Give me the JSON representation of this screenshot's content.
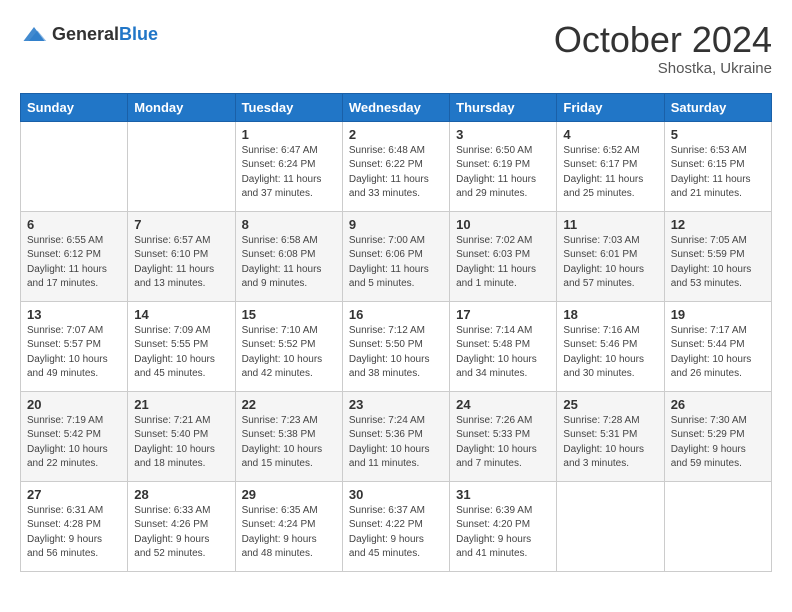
{
  "header": {
    "logo_general": "General",
    "logo_blue": "Blue",
    "month_year": "October 2024",
    "location": "Shostka, Ukraine"
  },
  "days_of_week": [
    "Sunday",
    "Monday",
    "Tuesday",
    "Wednesday",
    "Thursday",
    "Friday",
    "Saturday"
  ],
  "weeks": [
    [
      {
        "day": "",
        "sunrise": "",
        "sunset": "",
        "daylight": ""
      },
      {
        "day": "",
        "sunrise": "",
        "sunset": "",
        "daylight": ""
      },
      {
        "day": "1",
        "sunrise": "Sunrise: 6:47 AM",
        "sunset": "Sunset: 6:24 PM",
        "daylight": "Daylight: 11 hours and 37 minutes."
      },
      {
        "day": "2",
        "sunrise": "Sunrise: 6:48 AM",
        "sunset": "Sunset: 6:22 PM",
        "daylight": "Daylight: 11 hours and 33 minutes."
      },
      {
        "day": "3",
        "sunrise": "Sunrise: 6:50 AM",
        "sunset": "Sunset: 6:19 PM",
        "daylight": "Daylight: 11 hours and 29 minutes."
      },
      {
        "day": "4",
        "sunrise": "Sunrise: 6:52 AM",
        "sunset": "Sunset: 6:17 PM",
        "daylight": "Daylight: 11 hours and 25 minutes."
      },
      {
        "day": "5",
        "sunrise": "Sunrise: 6:53 AM",
        "sunset": "Sunset: 6:15 PM",
        "daylight": "Daylight: 11 hours and 21 minutes."
      }
    ],
    [
      {
        "day": "6",
        "sunrise": "Sunrise: 6:55 AM",
        "sunset": "Sunset: 6:12 PM",
        "daylight": "Daylight: 11 hours and 17 minutes."
      },
      {
        "day": "7",
        "sunrise": "Sunrise: 6:57 AM",
        "sunset": "Sunset: 6:10 PM",
        "daylight": "Daylight: 11 hours and 13 minutes."
      },
      {
        "day": "8",
        "sunrise": "Sunrise: 6:58 AM",
        "sunset": "Sunset: 6:08 PM",
        "daylight": "Daylight: 11 hours and 9 minutes."
      },
      {
        "day": "9",
        "sunrise": "Sunrise: 7:00 AM",
        "sunset": "Sunset: 6:06 PM",
        "daylight": "Daylight: 11 hours and 5 minutes."
      },
      {
        "day": "10",
        "sunrise": "Sunrise: 7:02 AM",
        "sunset": "Sunset: 6:03 PM",
        "daylight": "Daylight: 11 hours and 1 minute."
      },
      {
        "day": "11",
        "sunrise": "Sunrise: 7:03 AM",
        "sunset": "Sunset: 6:01 PM",
        "daylight": "Daylight: 10 hours and 57 minutes."
      },
      {
        "day": "12",
        "sunrise": "Sunrise: 7:05 AM",
        "sunset": "Sunset: 5:59 PM",
        "daylight": "Daylight: 10 hours and 53 minutes."
      }
    ],
    [
      {
        "day": "13",
        "sunrise": "Sunrise: 7:07 AM",
        "sunset": "Sunset: 5:57 PM",
        "daylight": "Daylight: 10 hours and 49 minutes."
      },
      {
        "day": "14",
        "sunrise": "Sunrise: 7:09 AM",
        "sunset": "Sunset: 5:55 PM",
        "daylight": "Daylight: 10 hours and 45 minutes."
      },
      {
        "day": "15",
        "sunrise": "Sunrise: 7:10 AM",
        "sunset": "Sunset: 5:52 PM",
        "daylight": "Daylight: 10 hours and 42 minutes."
      },
      {
        "day": "16",
        "sunrise": "Sunrise: 7:12 AM",
        "sunset": "Sunset: 5:50 PM",
        "daylight": "Daylight: 10 hours and 38 minutes."
      },
      {
        "day": "17",
        "sunrise": "Sunrise: 7:14 AM",
        "sunset": "Sunset: 5:48 PM",
        "daylight": "Daylight: 10 hours and 34 minutes."
      },
      {
        "day": "18",
        "sunrise": "Sunrise: 7:16 AM",
        "sunset": "Sunset: 5:46 PM",
        "daylight": "Daylight: 10 hours and 30 minutes."
      },
      {
        "day": "19",
        "sunrise": "Sunrise: 7:17 AM",
        "sunset": "Sunset: 5:44 PM",
        "daylight": "Daylight: 10 hours and 26 minutes."
      }
    ],
    [
      {
        "day": "20",
        "sunrise": "Sunrise: 7:19 AM",
        "sunset": "Sunset: 5:42 PM",
        "daylight": "Daylight: 10 hours and 22 minutes."
      },
      {
        "day": "21",
        "sunrise": "Sunrise: 7:21 AM",
        "sunset": "Sunset: 5:40 PM",
        "daylight": "Daylight: 10 hours and 18 minutes."
      },
      {
        "day": "22",
        "sunrise": "Sunrise: 7:23 AM",
        "sunset": "Sunset: 5:38 PM",
        "daylight": "Daylight: 10 hours and 15 minutes."
      },
      {
        "day": "23",
        "sunrise": "Sunrise: 7:24 AM",
        "sunset": "Sunset: 5:36 PM",
        "daylight": "Daylight: 10 hours and 11 minutes."
      },
      {
        "day": "24",
        "sunrise": "Sunrise: 7:26 AM",
        "sunset": "Sunset: 5:33 PM",
        "daylight": "Daylight: 10 hours and 7 minutes."
      },
      {
        "day": "25",
        "sunrise": "Sunrise: 7:28 AM",
        "sunset": "Sunset: 5:31 PM",
        "daylight": "Daylight: 10 hours and 3 minutes."
      },
      {
        "day": "26",
        "sunrise": "Sunrise: 7:30 AM",
        "sunset": "Sunset: 5:29 PM",
        "daylight": "Daylight: 9 hours and 59 minutes."
      }
    ],
    [
      {
        "day": "27",
        "sunrise": "Sunrise: 6:31 AM",
        "sunset": "Sunset: 4:28 PM",
        "daylight": "Daylight: 9 hours and 56 minutes."
      },
      {
        "day": "28",
        "sunrise": "Sunrise: 6:33 AM",
        "sunset": "Sunset: 4:26 PM",
        "daylight": "Daylight: 9 hours and 52 minutes."
      },
      {
        "day": "29",
        "sunrise": "Sunrise: 6:35 AM",
        "sunset": "Sunset: 4:24 PM",
        "daylight": "Daylight: 9 hours and 48 minutes."
      },
      {
        "day": "30",
        "sunrise": "Sunrise: 6:37 AM",
        "sunset": "Sunset: 4:22 PM",
        "daylight": "Daylight: 9 hours and 45 minutes."
      },
      {
        "day": "31",
        "sunrise": "Sunrise: 6:39 AM",
        "sunset": "Sunset: 4:20 PM",
        "daylight": "Daylight: 9 hours and 41 minutes."
      },
      {
        "day": "",
        "sunrise": "",
        "sunset": "",
        "daylight": ""
      },
      {
        "day": "",
        "sunrise": "",
        "sunset": "",
        "daylight": ""
      }
    ]
  ]
}
